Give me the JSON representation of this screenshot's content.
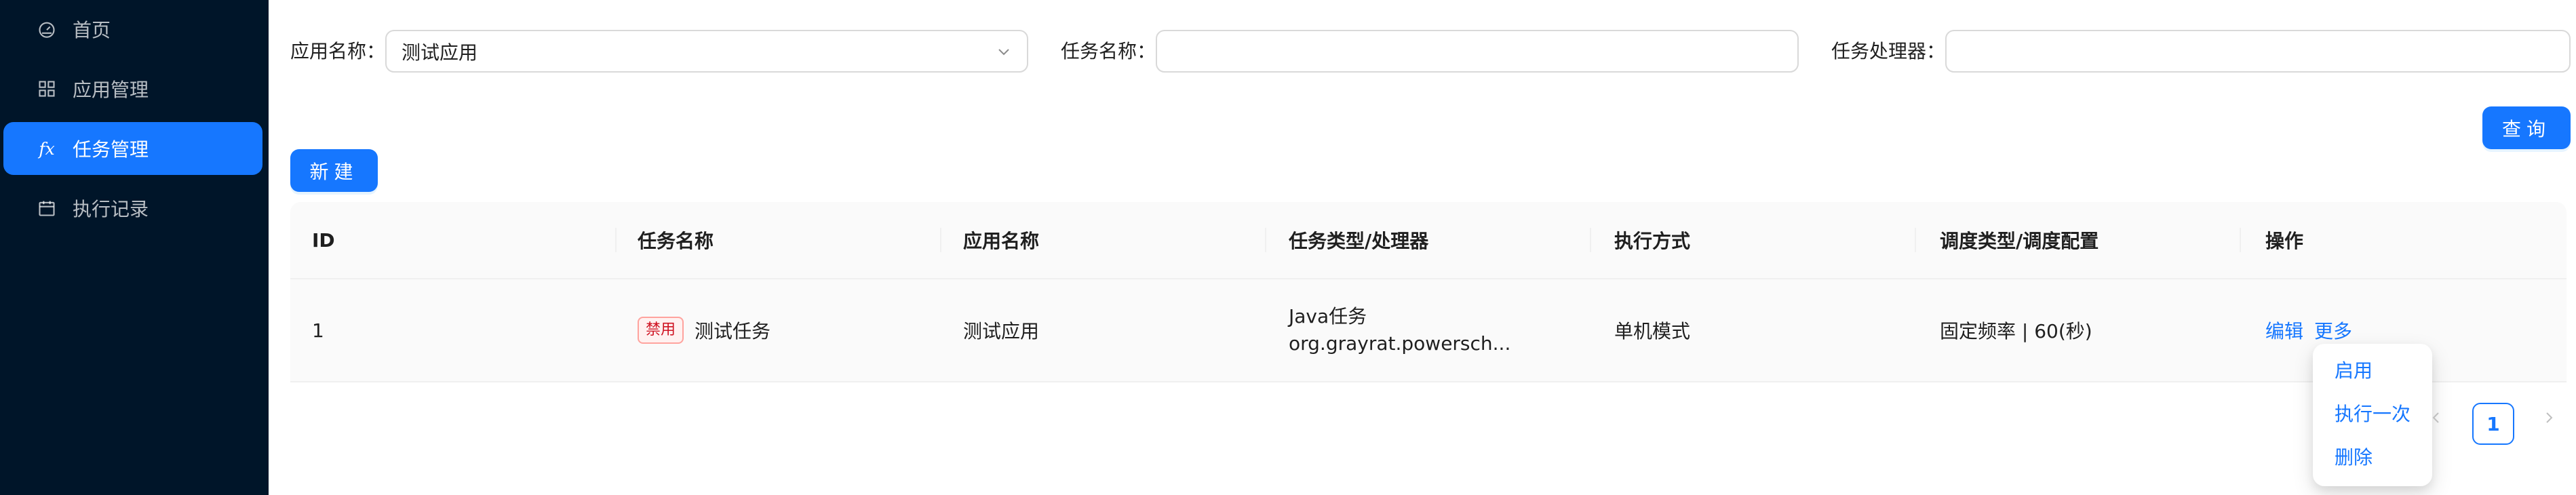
{
  "sidebar": {
    "items": [
      {
        "label": "首页",
        "icon": "dashboard-icon"
      },
      {
        "label": "应用管理",
        "icon": "appstore-icon"
      },
      {
        "label": "任务管理",
        "icon": "function-icon",
        "glyph": "fx",
        "active": true
      },
      {
        "label": "执行记录",
        "icon": "calendar-icon"
      }
    ]
  },
  "filters": {
    "app_label": "应用名称：",
    "app_value": "测试应用",
    "task_label": "任务名称：",
    "task_value": "",
    "processor_label": "任务处理器：",
    "processor_value": ""
  },
  "buttons": {
    "query": "查询",
    "create": "新建"
  },
  "table": {
    "columns": [
      "ID",
      "任务名称",
      "应用名称",
      "任务类型/处理器",
      "执行方式",
      "调度类型/调度配置",
      "操作"
    ],
    "rows": [
      {
        "id": "1",
        "status_tag": "禁用",
        "task_name": "测试任务",
        "app_name": "测试应用",
        "task_type": "Java任务",
        "processor": "org.grayrat.powersch...",
        "exec_mode": "单机模式",
        "schedule": "固定频率 | 60(秒)",
        "action_edit": "编辑",
        "action_more": "更多"
      }
    ]
  },
  "more_menu": {
    "items": [
      "启用",
      "执行一次",
      "删除"
    ]
  },
  "pagination": {
    "current_page": "1"
  },
  "colors": {
    "sidebar_bg": "#001529",
    "primary": "#1677ff",
    "tag_danger": "#cf1322"
  }
}
